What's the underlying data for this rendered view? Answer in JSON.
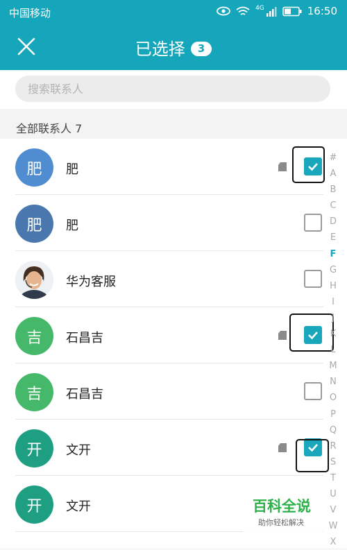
{
  "status_bar": {
    "carrier": "中国移动",
    "network": "4G",
    "time": "16:50"
  },
  "header": {
    "close_icon": "close-icon",
    "title": "已选择",
    "selected_count": "3"
  },
  "search": {
    "placeholder": "搜索联系人"
  },
  "section": {
    "label": "全部联系人  7"
  },
  "contacts": [
    {
      "name": "肥",
      "avatar_text": "肥",
      "avatar_color": "#4f8dd0",
      "sim_icon": true,
      "checked": true
    },
    {
      "name": "肥",
      "avatar_text": "肥",
      "avatar_color": "#4a77ad",
      "sim_icon": false,
      "checked": false
    },
    {
      "name": "华为客服",
      "avatar_text": "",
      "avatar_color": "#e8e8e8",
      "photo": true,
      "sim_icon": false,
      "checked": false
    },
    {
      "name": "石昌吉",
      "avatar_text": "吉",
      "avatar_color": "#46b86a",
      "sim_icon": true,
      "checked": true
    },
    {
      "name": "石昌吉",
      "avatar_text": "吉",
      "avatar_color": "#46b86a",
      "sim_icon": false,
      "checked": false
    },
    {
      "name": "文开",
      "avatar_text": "开",
      "avatar_color": "#1f9f82",
      "sim_icon": true,
      "checked": true
    },
    {
      "name": "文开",
      "avatar_text": "开",
      "avatar_color": "#1f9f82",
      "sim_icon": false,
      "checked": false
    }
  ],
  "index_letters": [
    "#",
    "A",
    "B",
    "C",
    "D",
    "E",
    "F",
    "G",
    "H",
    "I",
    "J",
    "K",
    "L",
    "M",
    "N",
    "O",
    "P",
    "Q",
    "R",
    "S",
    "T",
    "U",
    "V",
    "W",
    "X"
  ],
  "index_current": "F",
  "watermark": {
    "title": "百科全说",
    "subtitle": "助你轻松解决"
  },
  "colors": {
    "accent": "#16a6bb",
    "checkbox_on": "#1aa7bb"
  }
}
